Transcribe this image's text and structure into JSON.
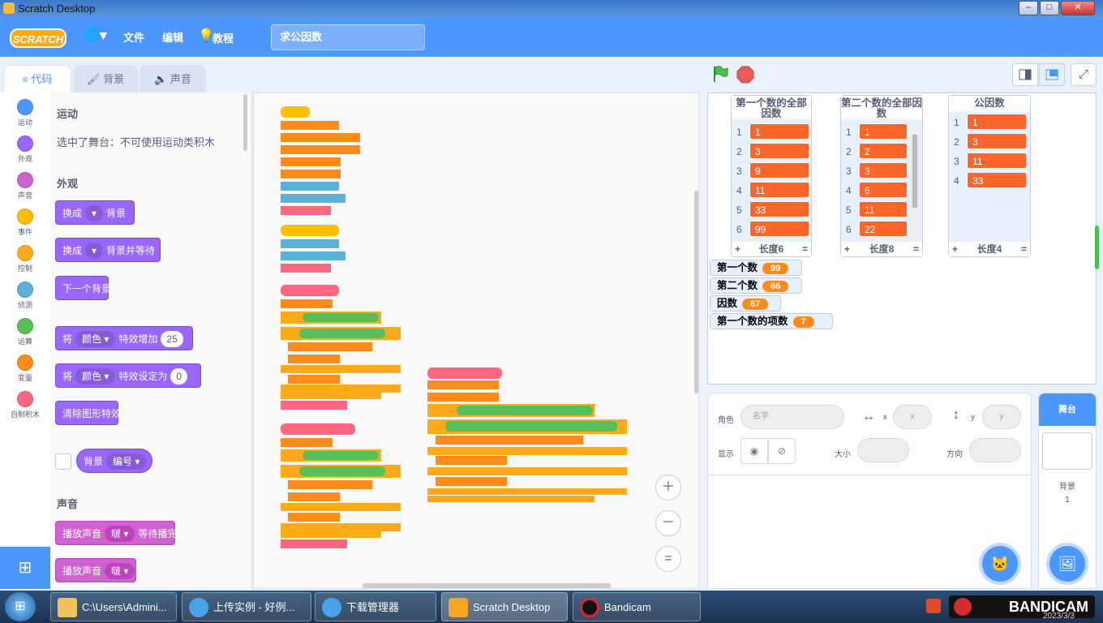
{
  "window": {
    "title": "Scratch Desktop"
  },
  "menubar": {
    "logo": "SCRATCH",
    "file": "文件",
    "edit": "编辑",
    "tutorials": "教程",
    "project_title": "求公因数"
  },
  "tabs": {
    "code": "代码",
    "costumes": "背景",
    "sounds": "声音"
  },
  "categories": [
    {
      "label": "运动",
      "color": "#4c97ff"
    },
    {
      "label": "外观",
      "color": "#9966ff"
    },
    {
      "label": "声音",
      "color": "#cf63cf"
    },
    {
      "label": "事件",
      "color": "#ffbf00"
    },
    {
      "label": "控制",
      "color": "#ffab19"
    },
    {
      "label": "侦测",
      "color": "#5cb1d6"
    },
    {
      "label": "运算",
      "color": "#59c059"
    },
    {
      "label": "变量",
      "color": "#ff8c1a"
    },
    {
      "label": "自制积木",
      "color": "#ff6680"
    }
  ],
  "palette": {
    "motion_header": "运动",
    "motion_note": "选中了舞台：不可使用运动类积木",
    "looks_header": "外观",
    "switch_backdrop": {
      "pre": "换成",
      "post": "背景"
    },
    "switch_backdrop_wait": {
      "pre": "换成",
      "post": "背景并等待"
    },
    "next_backdrop": "下一个背景",
    "change_effect": {
      "pre": "将",
      "effect": "颜色",
      "mid": "特效增加",
      "value": "25"
    },
    "set_effect": {
      "pre": "将",
      "effect": "颜色",
      "mid": "特效设定为",
      "value": "0"
    },
    "clear_effects": "清除图形特效",
    "backdrop_reporter": {
      "label": "背景",
      "option": "编号"
    },
    "sound_header": "声音",
    "play_until_done": {
      "pre": "播放声音",
      "sound": "啵",
      "post": "等待播完"
    },
    "play_sound": {
      "pre": "播放声音",
      "sound": "啵"
    }
  },
  "stage": {
    "lists": [
      {
        "title": "第一个数的全部因数",
        "items": [
          "1",
          "3",
          "9",
          "11",
          "33",
          "99"
        ],
        "indices": [
          "1",
          "2",
          "3",
          "4",
          "5",
          "6"
        ],
        "footer": "长度6"
      },
      {
        "title": "第二个数的全部因数",
        "items": [
          "1",
          "2",
          "3",
          "6",
          "11",
          "22"
        ],
        "indices": [
          "1",
          "2",
          "3",
          "4",
          "5",
          "6"
        ],
        "footer": "长度8"
      },
      {
        "title": "公因数",
        "items": [
          "1",
          "3",
          "11",
          "33"
        ],
        "indices": [
          "1",
          "2",
          "3",
          "4"
        ],
        "footer": "长度4"
      }
    ],
    "list_footer_add": "+",
    "list_footer_resize": "=",
    "variables": [
      {
        "name": "第一个数",
        "value": "99"
      },
      {
        "name": "第二个数",
        "value": "66"
      },
      {
        "name": "因数",
        "value": "67"
      },
      {
        "name": "第一个数的项数",
        "value": "7"
      }
    ]
  },
  "sprite_info": {
    "sprite_label": "角色",
    "sprite_placeholder": "名字",
    "x_label": "x",
    "x_placeholder": "x",
    "y_label": "y",
    "y_placeholder": "y",
    "show_label": "显示",
    "size_label": "大小",
    "direction_label": "方向"
  },
  "stage_pane": {
    "header": "舞台",
    "backdrops_label": "背景",
    "backdrops_count": "1"
  },
  "taskbar": {
    "items": [
      {
        "label": "C:\\Users\\Admini..."
      },
      {
        "label": "上传实例 - 好例..."
      },
      {
        "label": "下载管理器"
      },
      {
        "label": "Scratch Desktop"
      },
      {
        "label": "Bandicam"
      }
    ],
    "tray_brand": "BANDICAM",
    "clock_date": "2023/3/3"
  }
}
